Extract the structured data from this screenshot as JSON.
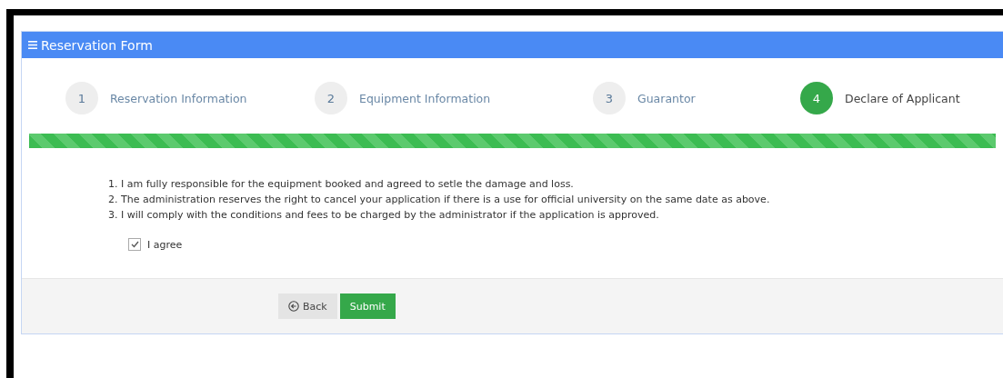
{
  "panel": {
    "title": "Reservation Form"
  },
  "steps": [
    {
      "number": "1",
      "label": "Reservation Information",
      "selected": false
    },
    {
      "number": "2",
      "label": "Equipment Information",
      "selected": false
    },
    {
      "number": "3",
      "label": "Guarantor",
      "selected": false
    },
    {
      "number": "4",
      "label": "Declare of Applicant",
      "selected": true
    }
  ],
  "progress": {
    "level": 1
  },
  "terms": [
    "1. I am fully responsible for the equipment booked and agreed to setle the damage and loss.",
    "2. The administration reserves the right to cancel your application if there is a use for official university on the same date as above.",
    "3. I will comply with the conditions and fees to be charged by the administrator if the application is approved."
  ],
  "agree": {
    "label": "I agree",
    "checked": true
  },
  "buttons": {
    "back": "Back",
    "submit": "Submit"
  }
}
